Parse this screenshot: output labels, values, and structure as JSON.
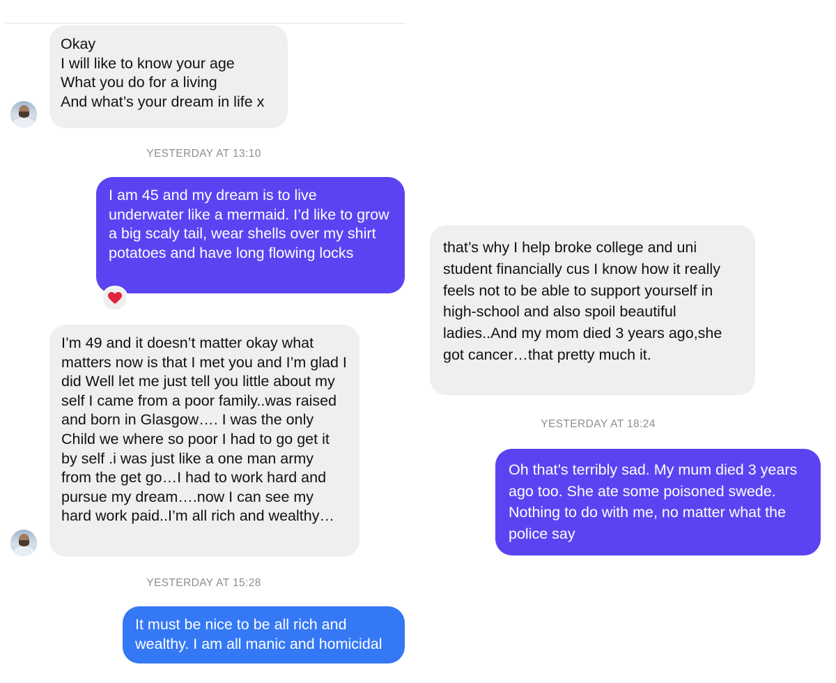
{
  "colors": {
    "received_bubble": "#efefef",
    "sent_bubble_purple": "#5a44f2",
    "sent_bubble_blue": "#3478f6",
    "timestamp": "#8e8e93",
    "reaction_heart": "#e0263f"
  },
  "left_column": {
    "messages": [
      {
        "from": "them",
        "text": "Okay\nI will like to know your age\nWhat you do for a living\nAnd what’s your dream in life x"
      },
      {
        "type": "timestamp",
        "text": "YESTERDAY AT 13:10"
      },
      {
        "from": "me",
        "text": "I am 45 and my dream is to live underwater like a mermaid. I’d like to grow a big scaly tail, wear shells over my shirt potatoes and have long flowing locks",
        "reaction_icon": "heart-icon"
      },
      {
        "from": "them",
        "text": "I’m 49 and it doesn’t matter okay what matters now is that I met you and I’m glad I did Well let me just tell you little about my self I came from a poor family..was raised and born in Glasgow…. I was the only Child we where so poor I had to go get it by self .i was just like a one man army from the get go…I had to work hard and pursue my dream….now I can see my hard work paid..I’m all rich and wealthy…"
      },
      {
        "type": "timestamp",
        "text": "YESTERDAY AT 15:28"
      },
      {
        "from": "me",
        "text": "It must be nice to be all rich and wealthy. I am all manic and homicidal"
      }
    ]
  },
  "right_column": {
    "messages": [
      {
        "from": "them",
        "text": "that’s why I help broke college and uni student financially cus I know how it really feels not to be able to support yourself in high-school and also spoil beautiful ladies..And my mom died 3 years ago,she got cancer…that pretty much it."
      },
      {
        "type": "timestamp",
        "text": "YESTERDAY AT 18:24"
      },
      {
        "from": "me",
        "text": "Oh that’s terribly sad. My mum died 3 years ago too. She ate some poisoned swede. Nothing to do with me, no matter what the police say"
      }
    ]
  }
}
